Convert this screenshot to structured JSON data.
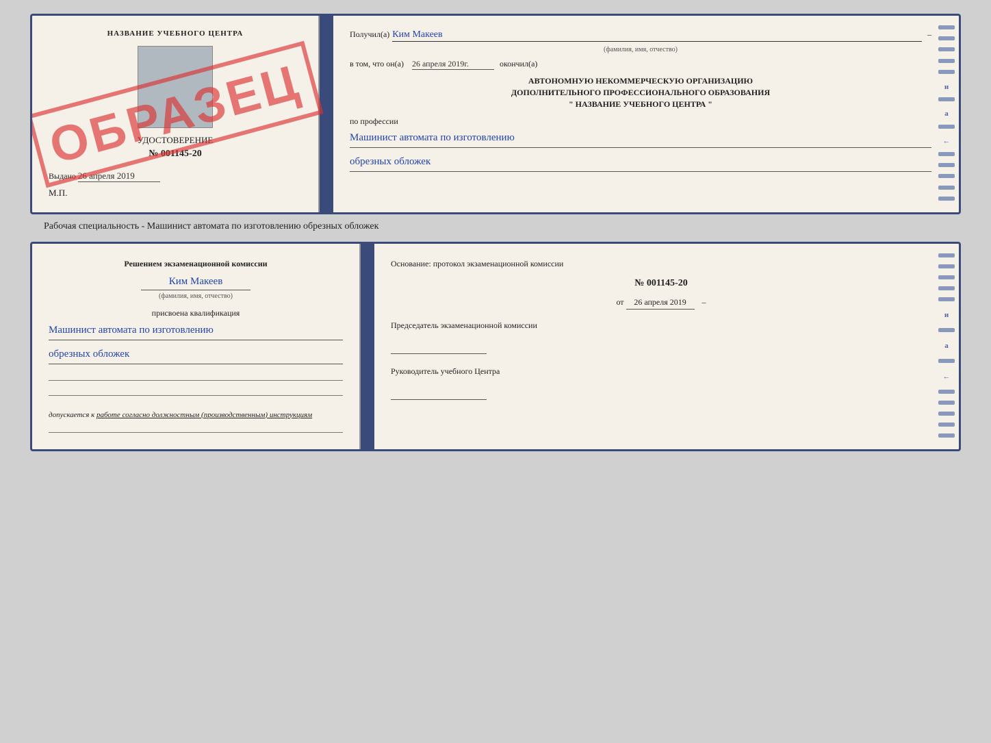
{
  "page": {
    "background": "#d0d0d0"
  },
  "top_document": {
    "left": {
      "header": "НАЗВАНИЕ УЧЕБНОГО ЦЕНТРА",
      "certificate_title": "УДОСТОВЕРЕНИЕ",
      "certificate_number": "№ 001145-20",
      "issued_label": "Выдано",
      "issued_date": "26 апреля 2019",
      "mp_label": "М.П.",
      "watermark": "ОБРАЗЕЦ"
    },
    "right": {
      "received_label": "Получил(а)",
      "recipient_name": "Ким Макеев",
      "name_sublabel": "(фамилия, имя, отчество)",
      "in_that_label": "в том, что он(а)",
      "date_value": "26 апреля 2019г.",
      "finished_label": "окончил(а)",
      "org_line1": "АВТОНОМНУЮ НЕКОММЕРЧЕСКУЮ ОРГАНИЗАЦИЮ",
      "org_line2": "ДОПОЛНИТЕЛЬНОГО ПРОФЕССИОНАЛЬНОГО ОБРАЗОВАНИЯ",
      "org_line3": "\"  НАЗВАНИЕ УЧЕБНОГО ЦЕНТРА  \"",
      "profession_label": "по профессии",
      "profession_line1": "Машинист автомата по изготовлению",
      "profession_line2": "обрезных обложек"
    }
  },
  "separator": {
    "text": "Рабочая специальность - Машинист автомата по изготовлению обрезных обложек"
  },
  "bottom_document": {
    "left": {
      "decision_header": "Решением экзаменационной комиссии",
      "person_name": "Ким Макеев",
      "person_sublabel": "(фамилия, имя, отчество)",
      "assigned_label": "присвоена квалификация",
      "qualification_line1": "Машинист автомата по изготовлению",
      "qualification_line2": "обрезных обложек",
      "allow_text": "допускается к",
      "allow_underline": "работе согласно должностным (производственным) инструкциям"
    },
    "right": {
      "basis_label": "Основание: протокол экзаменационной комиссии",
      "protocol_number": "№ 001145-20",
      "date_prefix": "от",
      "date_value": "26 апреля 2019",
      "commission_chair_label": "Председатель экзаменационной комиссии",
      "center_head_label": "Руководитель учебного Центра"
    }
  },
  "deco": {
    "side_letters": [
      "и",
      "а",
      "←"
    ],
    "lines_count": 12
  }
}
